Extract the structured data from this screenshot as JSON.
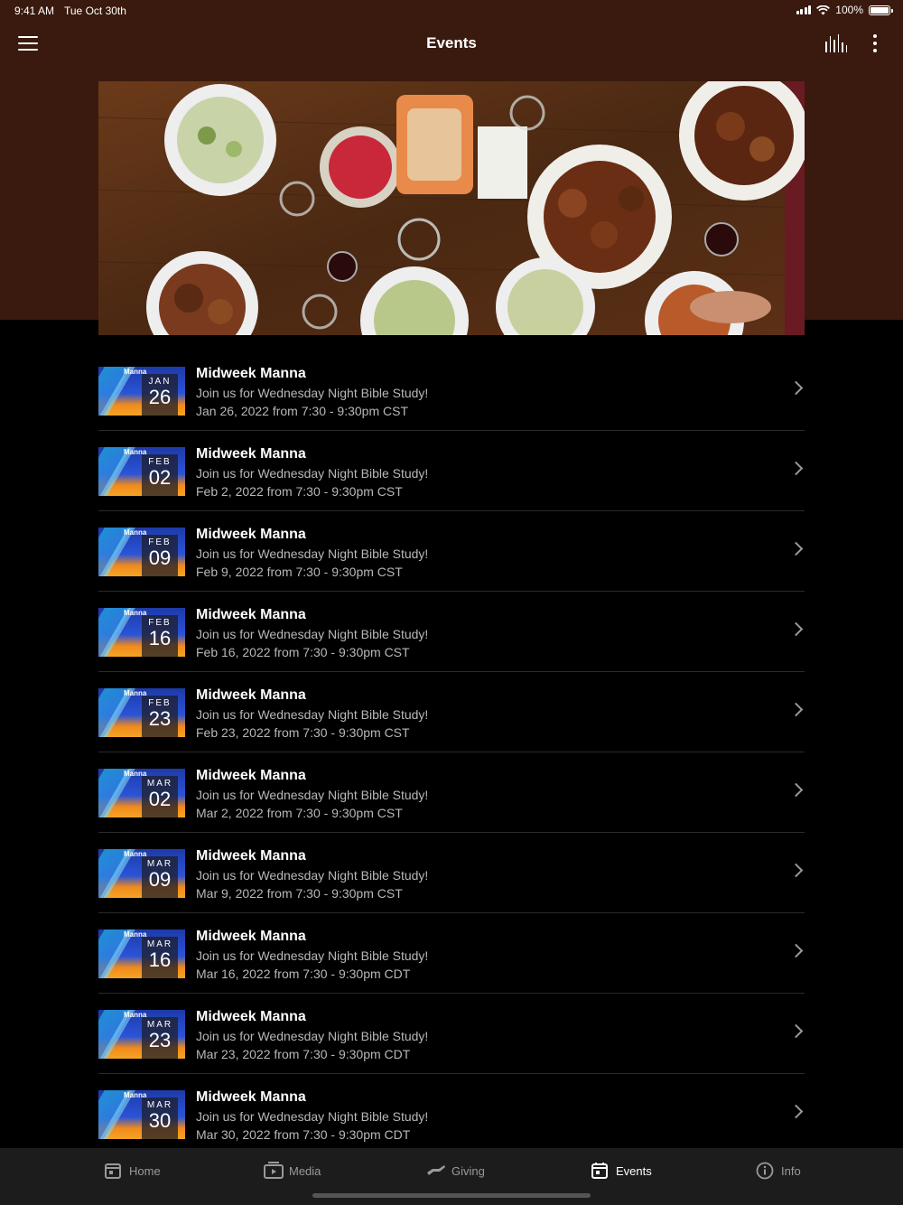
{
  "status": {
    "time": "9:41 AM",
    "date": "Tue Oct 30th",
    "battery": "100%"
  },
  "nav": {
    "title": "Events"
  },
  "events": [
    {
      "month": "JAN",
      "day": "26",
      "title": "Midweek Manna",
      "description": "Join us for Wednesday Night Bible Study!",
      "when": "Jan 26, 2022 from 7:30 - 9:30pm CST"
    },
    {
      "month": "FEB",
      "day": "02",
      "title": "Midweek Manna",
      "description": "Join us for Wednesday Night Bible Study!",
      "when": "Feb 2, 2022 from 7:30 - 9:30pm CST"
    },
    {
      "month": "FEB",
      "day": "09",
      "title": "Midweek Manna",
      "description": "Join us for Wednesday Night Bible Study!",
      "when": "Feb 9, 2022 from 7:30 - 9:30pm CST"
    },
    {
      "month": "FEB",
      "day": "16",
      "title": "Midweek Manna",
      "description": "Join us for Wednesday Night Bible Study!",
      "when": "Feb 16, 2022 from 7:30 - 9:30pm CST"
    },
    {
      "month": "FEB",
      "day": "23",
      "title": "Midweek Manna",
      "description": "Join us for Wednesday Night Bible Study!",
      "when": "Feb 23, 2022 from 7:30 - 9:30pm CST"
    },
    {
      "month": "MAR",
      "day": "02",
      "title": "Midweek Manna",
      "description": "Join us for Wednesday Night Bible Study!",
      "when": "Mar 2, 2022 from 7:30 - 9:30pm CST"
    },
    {
      "month": "MAR",
      "day": "09",
      "title": "Midweek Manna",
      "description": "Join us for Wednesday Night Bible Study!",
      "when": "Mar 9, 2022 from 7:30 - 9:30pm CST"
    },
    {
      "month": "MAR",
      "day": "16",
      "title": "Midweek Manna",
      "description": "Join us for Wednesday Night Bible Study!",
      "when": "Mar 16, 2022 from 7:30 - 9:30pm CDT"
    },
    {
      "month": "MAR",
      "day": "23",
      "title": "Midweek Manna",
      "description": "Join us for Wednesday Night Bible Study!",
      "when": "Mar 23, 2022 from 7:30 - 9:30pm CDT"
    },
    {
      "month": "MAR",
      "day": "30",
      "title": "Midweek Manna",
      "description": "Join us for Wednesday Night Bible Study!",
      "when": "Mar 30, 2022 from 7:30 - 9:30pm CDT"
    }
  ],
  "thumbnail": {
    "brand": "Manna"
  },
  "tabs": [
    {
      "label": "Home",
      "icon": "home-icon",
      "active": false
    },
    {
      "label": "Media",
      "icon": "media-icon",
      "active": false
    },
    {
      "label": "Giving",
      "icon": "giving-icon",
      "active": false
    },
    {
      "label": "Events",
      "icon": "calendar-icon",
      "active": true
    },
    {
      "label": "Info",
      "icon": "info-icon",
      "active": false
    }
  ],
  "colors": {
    "header_bg": "#3a1a0e",
    "page_bg": "#000000",
    "tab_bar_bg": "#1c1c1c",
    "secondary_text": "#b8b8b8"
  }
}
